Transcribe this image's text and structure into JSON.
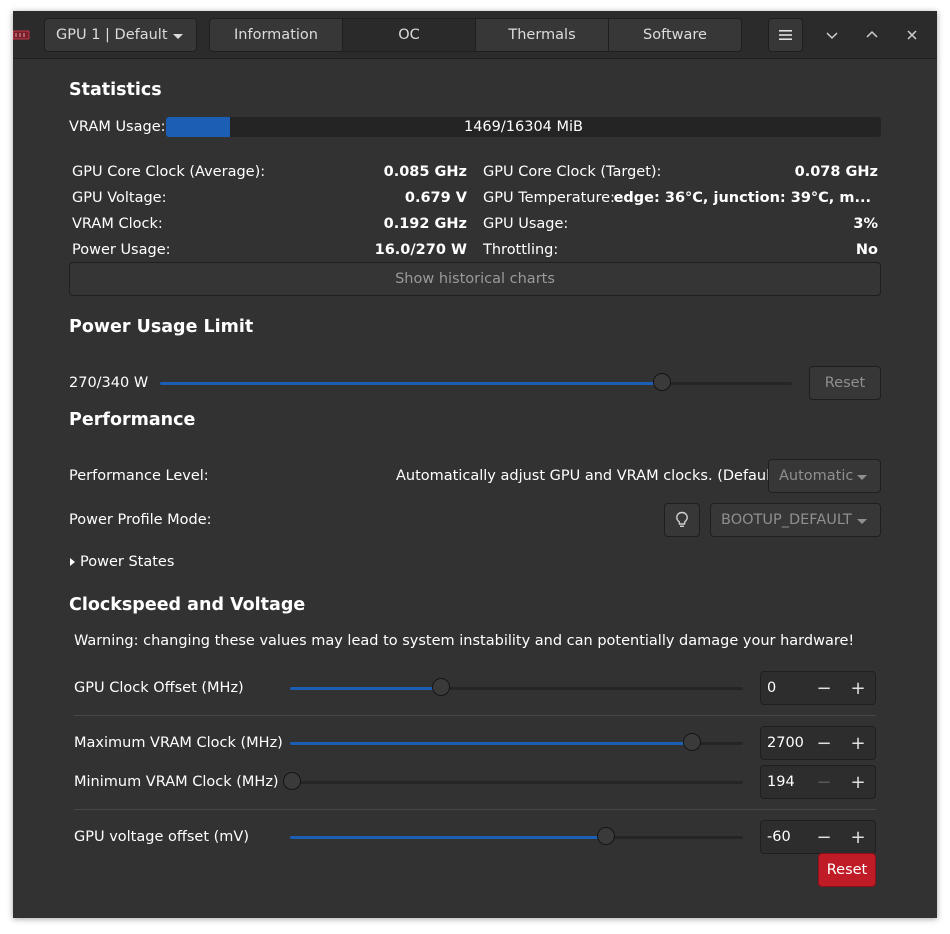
{
  "header": {
    "gpu_selector": "GPU 1 | Default",
    "tabs": [
      {
        "label": "Information"
      },
      {
        "label": "OC"
      },
      {
        "label": "Thermals"
      },
      {
        "label": "Software"
      }
    ],
    "active_tab": "OC"
  },
  "statistics": {
    "title": "Statistics",
    "vram_label": "VRAM Usage:",
    "vram_text": "1469/16304 MiB",
    "vram_used": 1469,
    "vram_total": 16304,
    "rows": [
      {
        "label": "GPU Core Clock (Average):",
        "value": "0.085 GHz"
      },
      {
        "label": "GPU Core Clock (Target):",
        "value": "0.078 GHz"
      },
      {
        "label": "GPU Voltage:",
        "value": "0.679 V"
      },
      {
        "label": "GPU Temperature:",
        "value": "edge: 36°C, junction: 39°C, m..."
      },
      {
        "label": "VRAM Clock:",
        "value": "0.192 GHz"
      },
      {
        "label": "GPU Usage:",
        "value": "3%"
      },
      {
        "label": "Power Usage:",
        "value": "16.0/270 W"
      },
      {
        "label": "Throttling:",
        "value": "No"
      }
    ],
    "history_button": "Show historical charts"
  },
  "power_limit": {
    "title": "Power Usage Limit",
    "value_text": "270/340 W",
    "fraction": 0.794,
    "reset_label": "Reset"
  },
  "performance": {
    "title": "Performance",
    "level_label": "Performance Level:",
    "level_description": "Automatically adjust GPU and VRAM clocks. (Default)",
    "level_value": "Automatic",
    "profile_label": "Power Profile Mode:",
    "profile_value": "BOOTUP_DEFAULT",
    "power_states_label": "Power States"
  },
  "clocks": {
    "title": "Clockspeed and Voltage",
    "warning": "Warning: changing these values may lead to system instability and can potentially damage your hardware!",
    "items": [
      {
        "label": "GPU Clock Offset (MHz)",
        "value": "0",
        "fraction": 0.333
      },
      {
        "label": "Maximum VRAM Clock (MHz)",
        "value": "2700",
        "fraction": 0.887
      },
      {
        "label": "Minimum VRAM Clock (MHz)",
        "value": "194",
        "fraction": 0.0
      },
      {
        "label": "GPU voltage offset (mV)",
        "value": "-60",
        "fraction": 0.698
      }
    ],
    "minus": "−",
    "plus": "+",
    "reset_label": "Reset"
  },
  "colors": {
    "accent": "#1a5fb4",
    "destructive": "#c01c28",
    "window_bg": "#323232"
  }
}
